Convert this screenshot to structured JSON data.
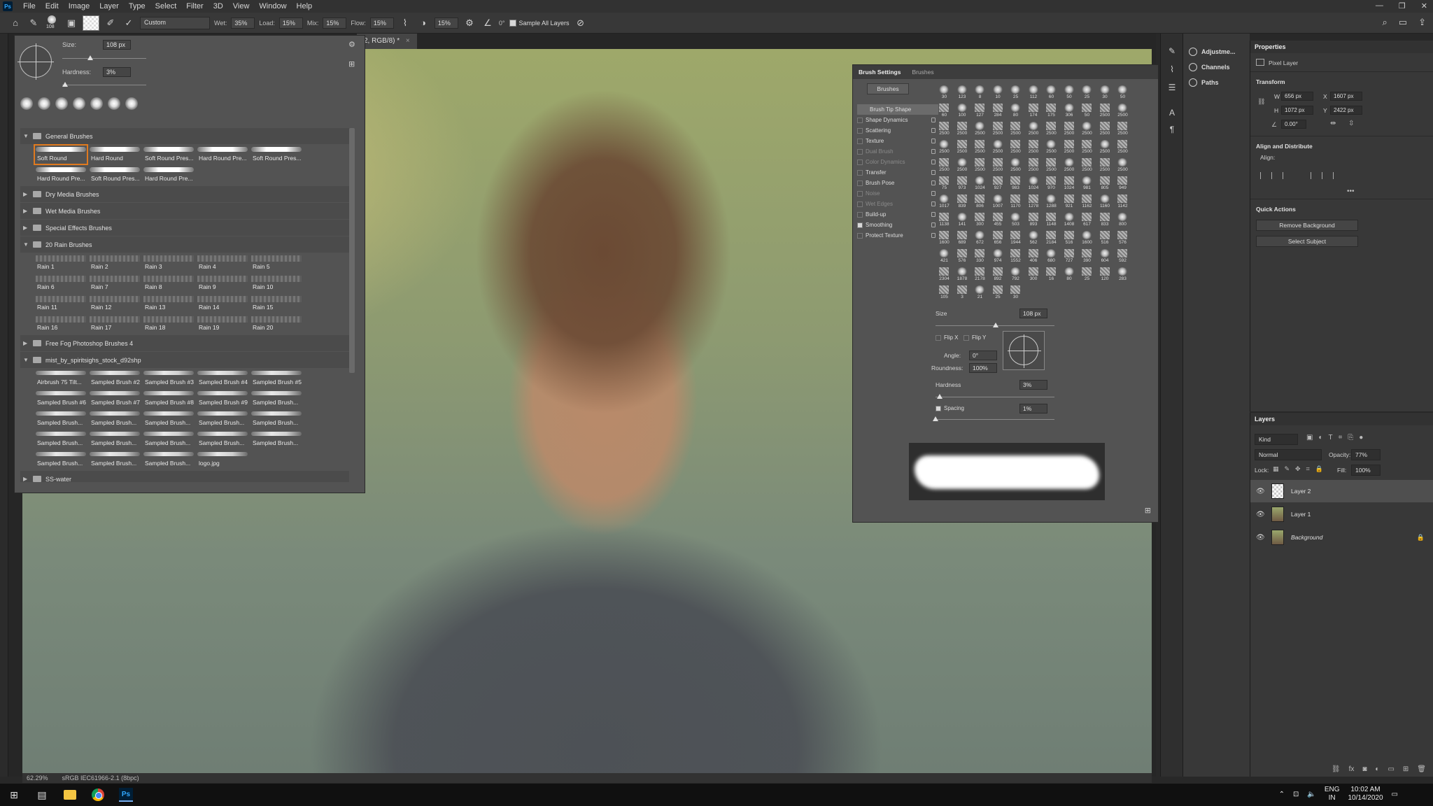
{
  "menubar": {
    "logo": "Ps",
    "items": [
      "File",
      "Edit",
      "Image",
      "Layer",
      "Type",
      "Select",
      "Filter",
      "3D",
      "View",
      "Window",
      "Help"
    ],
    "controls": [
      "—",
      "❐",
      "✕"
    ]
  },
  "options": {
    "brush_size_badge": "108",
    "preset_select": "Custom",
    "wet_label": "Wet:",
    "wet_value": "35%",
    "load_label": "Load:",
    "load_value": "15%",
    "mix_label": "Mix:",
    "mix_value": "15%",
    "flow_label": "Flow:",
    "flow_value": "15%",
    "smoothing_value": "15%",
    "angle_value": "0°",
    "sample_all_layers": "Sample All Layers"
  },
  "document": {
    "tab_title": "2, RGB/8) *",
    "zoom": "62.29%",
    "color_profile": "sRGB IEC61966-2.1 (8bpc)"
  },
  "brush_picker": {
    "size_label": "Size:",
    "size_value": "108 px",
    "hardness_label": "Hardness:",
    "hardness_value": "3%",
    "size_level": 0.33,
    "hardness_level": 0.03,
    "folders": [
      {
        "name": "General Brushes",
        "open": true,
        "kind": "soft",
        "brushes": [
          "Soft Round",
          "Hard Round",
          "Soft Round Pres...",
          "Hard Round Pre...",
          "Soft Round Pres...",
          "Hard Round Pre...",
          "Soft Round Pres...",
          "Hard Round Pre..."
        ]
      },
      {
        "name": "Dry Media Brushes",
        "open": false,
        "brushes": []
      },
      {
        "name": "Wet Media Brushes",
        "open": false,
        "brushes": []
      },
      {
        "name": "Special Effects Brushes",
        "open": false,
        "brushes": []
      },
      {
        "name": "20 Rain Brushes",
        "open": true,
        "kind": "rain",
        "brushes": [
          "Rain 1",
          "Rain 2",
          "Rain 3",
          "Rain 4",
          "Rain 5",
          "Rain 6",
          "Rain 7",
          "Rain 8",
          "Rain 9",
          "Rain 10",
          "Rain 11",
          "Rain 12",
          "Rain 13",
          "Rain 14",
          "Rain 15",
          "Rain 16",
          "Rain 17",
          "Rain 18",
          "Rain 19",
          "Rain 20"
        ]
      },
      {
        "name": "Free Fog Photoshop Brushes 4",
        "open": false,
        "brushes": []
      },
      {
        "name": "mist_by_spiritsighs_stock_d92shp",
        "open": true,
        "kind": "smp",
        "brushes": [
          "Airbrush 75 Tilt...",
          "Sampled Brush #2",
          "Sampled Brush #3",
          "Sampled Brush #4",
          "Sampled Brush #5",
          "Sampled Brush #6",
          "Sampled Brush #7",
          "Sampled Brush #8",
          "Sampled Brush #9",
          "Sampled Brush...",
          "Sampled Brush...",
          "Sampled Brush...",
          "Sampled Brush...",
          "Sampled Brush...",
          "Sampled Brush...",
          "Sampled Brush...",
          "Sampled Brush...",
          "Sampled Brush...",
          "Sampled Brush...",
          "Sampled Brush...",
          "Sampled Brush...",
          "Sampled Brush...",
          "Sampled Brush...",
          "logo.jpg"
        ]
      },
      {
        "name": "SS-water",
        "open": false,
        "brushes": []
      }
    ]
  },
  "brush_settings": {
    "tabs": [
      "Brush Settings",
      "Brushes"
    ],
    "brushes_button": "Brushes",
    "options": [
      {
        "label": "Brush Tip Shape",
        "active": true,
        "check": false,
        "dim": false,
        "lock": false
      },
      {
        "label": "Shape Dynamics",
        "active": false,
        "check": false,
        "dim": false,
        "lock": true
      },
      {
        "label": "Scattering",
        "active": false,
        "check": false,
        "dim": false,
        "lock": true
      },
      {
        "label": "Texture",
        "active": false,
        "check": false,
        "dim": false,
        "lock": true
      },
      {
        "label": "Dual Brush",
        "active": false,
        "check": false,
        "dim": true,
        "lock": true
      },
      {
        "label": "Color Dynamics",
        "active": false,
        "check": false,
        "dim": true,
        "lock": true
      },
      {
        "label": "Transfer",
        "active": false,
        "check": false,
        "dim": false,
        "lock": true
      },
      {
        "label": "Brush Pose",
        "active": false,
        "check": false,
        "dim": false,
        "lock": true
      },
      {
        "label": "Noise",
        "active": false,
        "check": false,
        "dim": true,
        "lock": true
      },
      {
        "label": "Wet Edges",
        "active": false,
        "check": false,
        "dim": true,
        "lock": true
      },
      {
        "label": "Build-up",
        "active": false,
        "check": false,
        "dim": false,
        "lock": true
      },
      {
        "label": "Smoothing",
        "active": false,
        "check": true,
        "dim": false,
        "lock": true
      },
      {
        "label": "Protect Texture",
        "active": false,
        "check": false,
        "dim": false,
        "lock": true
      }
    ],
    "tips": [
      "30",
      "123",
      "8",
      "10",
      "25",
      "112",
      "60",
      "50",
      "25",
      "30",
      "50",
      "60",
      "100",
      "127",
      "284",
      "80",
      "174",
      "175",
      "306",
      "50",
      "2500",
      "2500",
      "2500",
      "2500",
      "2500",
      "2500",
      "2500",
      "2500",
      "2500",
      "2500",
      "2500",
      "2500",
      "2500",
      "2500",
      "2500",
      "2500",
      "2500",
      "2500",
      "2500",
      "2500",
      "2500",
      "2500",
      "2500",
      "2500",
      "2500",
      "2500",
      "2500",
      "2500",
      "2500",
      "2500",
      "2500",
      "2500",
      "2500",
      "2500",
      "2500",
      "75",
      "973",
      "1024",
      "927",
      "983",
      "1024",
      "970",
      "1024",
      "981",
      "805",
      "949",
      "1017",
      "839",
      "806",
      "1007",
      "1170",
      "1278",
      "1288",
      "921",
      "1162",
      "1160",
      "1142",
      "1138",
      "141",
      "300",
      "455",
      "503",
      "893",
      "1148",
      "1408",
      "617",
      "833",
      "800",
      "1600",
      "689",
      "672",
      "656",
      "1944",
      "562",
      "2184",
      "516",
      "1600",
      "516",
      "576",
      "421",
      "576",
      "330",
      "974",
      "1552",
      "406",
      "680",
      "727",
      "390",
      "604",
      "592",
      "2304",
      "1878",
      "2178",
      "892",
      "792",
      "300",
      "16",
      "80",
      "25",
      "120",
      "283",
      "105",
      "3",
      "21",
      "25",
      "30"
    ],
    "size_label": "Size",
    "size_value": "108 px",
    "flip_x": "Flip X",
    "flip_y": "Flip Y",
    "angle_label": "Angle:",
    "angle_value": "0°",
    "roundness_label": "Roundness:",
    "roundness_value": "100%",
    "hardness_label": "Hardness",
    "hardness_value": "3%",
    "spacing_label": "Spacing",
    "spacing_value": "1%",
    "spacing_checked": true
  },
  "dock": {
    "mini_items": [
      "Adjustme...",
      "Channels",
      "Paths"
    ]
  },
  "properties": {
    "title": "Properties",
    "layer_type": "Pixel Layer",
    "transform_title": "Transform",
    "w_label": "W",
    "w_value": "656 px",
    "h_label": "H",
    "h_value": "1072 px",
    "x_label": "X",
    "x_value": "1607 px",
    "y_label": "Y",
    "y_value": "2422 px",
    "angle_value": "0.00°",
    "align_title": "Align and Distribute",
    "align_label": "Align:",
    "quick_title": "Quick Actions",
    "remove_bg": "Remove Background",
    "select_subject": "Select Subject"
  },
  "layers": {
    "title": "Layers",
    "kind": "Kind",
    "blend": "Normal",
    "opacity_label": "Opacity:",
    "opacity_value": "77%",
    "lock_label": "Lock:",
    "fill_label": "Fill:",
    "fill_value": "100%",
    "items": [
      {
        "name": "Layer 2",
        "selected": true,
        "italic": false
      },
      {
        "name": "Layer 1",
        "selected": false,
        "italic": false
      },
      {
        "name": "Background",
        "selected": false,
        "italic": true
      }
    ]
  },
  "taskbar": {
    "lang": "ENG",
    "region": "IN",
    "time": "10:02 AM",
    "date": "10/14/2020"
  }
}
